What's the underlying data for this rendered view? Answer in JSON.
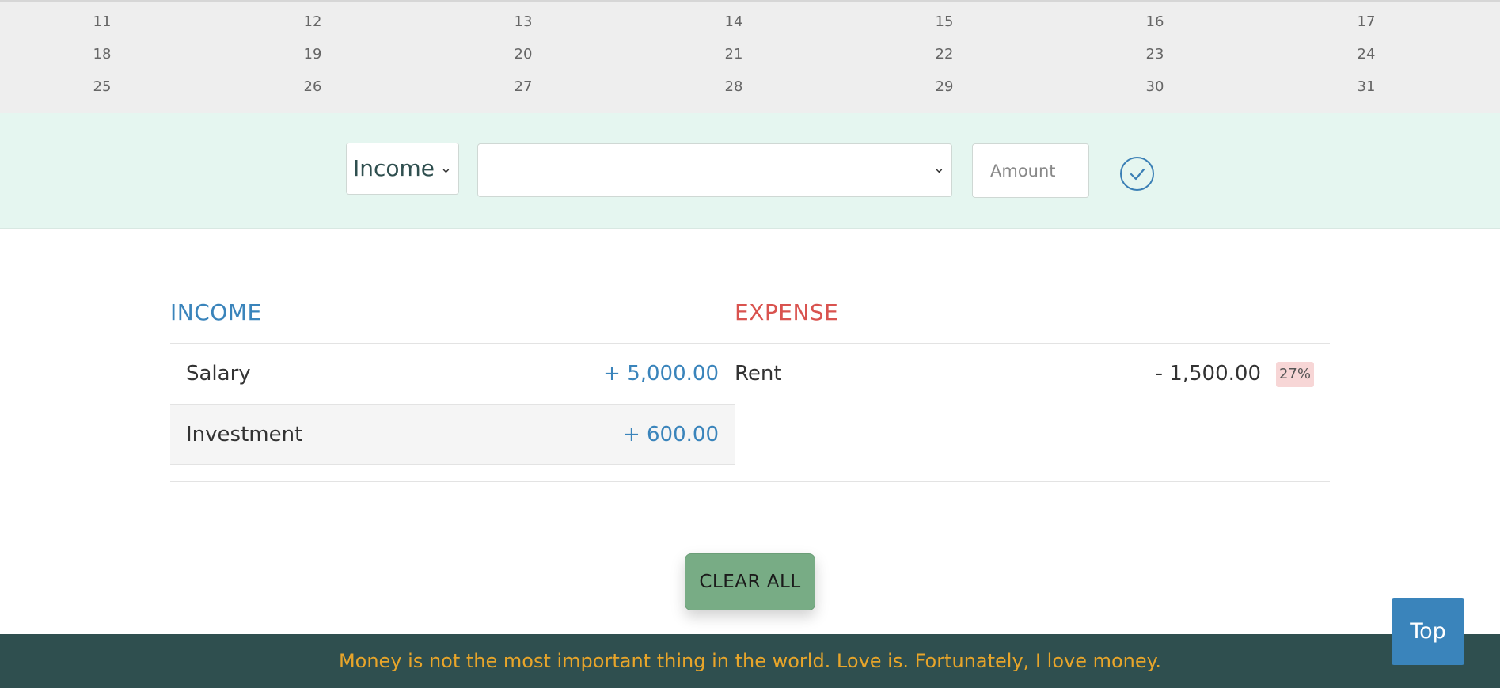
{
  "calendar": {
    "weeks": [
      [
        "11",
        "12",
        "13",
        "14",
        "15",
        "16",
        "17"
      ],
      [
        "18",
        "19",
        "20",
        "21",
        "22",
        "23",
        "24"
      ],
      [
        "25",
        "26",
        "27",
        "28",
        "29",
        "30",
        "31"
      ]
    ]
  },
  "entry_form": {
    "type_select": {
      "value": "Income"
    },
    "category_select": {
      "value": ""
    },
    "amount_input": {
      "placeholder": "Amount",
      "value": ""
    },
    "confirm_icon": "check-circle-icon"
  },
  "income": {
    "title": "INCOME",
    "items": [
      {
        "label": "Salary",
        "value": "+ 5,000.00"
      },
      {
        "label": "Investment",
        "value": "+ 600.00"
      }
    ]
  },
  "expense": {
    "title": "EXPENSE",
    "items": [
      {
        "label": "Rent",
        "value": "- 1,500.00",
        "percent": "27%"
      }
    ]
  },
  "actions": {
    "clear_all_label": "CLEAR ALL",
    "top_label": "Top"
  },
  "footer": {
    "quote": "Money is not the most important thing in the world. Love is. Fortunately, I love money."
  },
  "colors": {
    "income": "#3a84bb",
    "expense": "#d9534f",
    "footer_bg": "#2f4f4f",
    "footer_text": "#e8a52a",
    "entry_band": "#e5f6f0",
    "clear_button": "#78ac85"
  }
}
